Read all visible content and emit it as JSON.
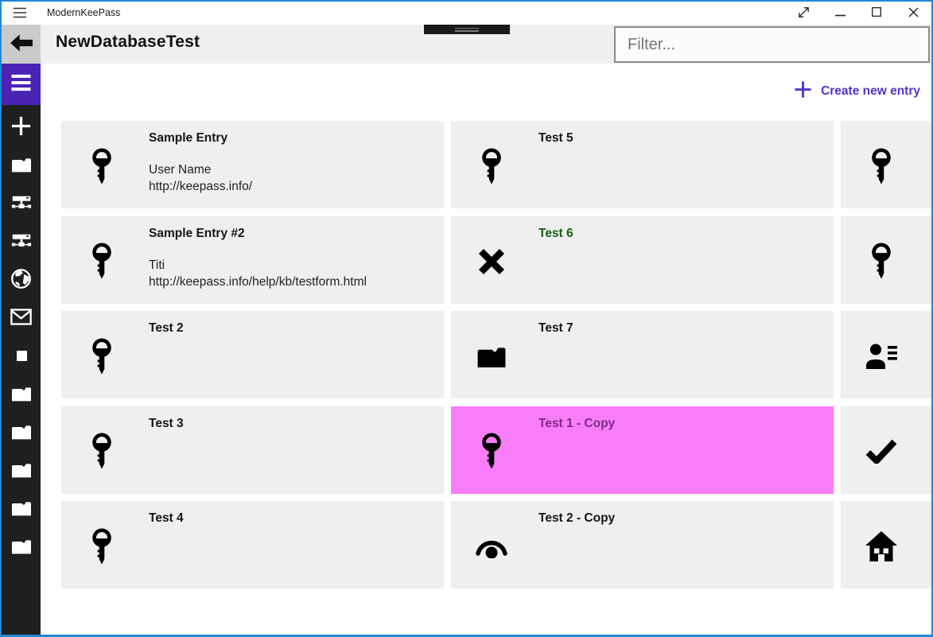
{
  "window": {
    "title": "ModernKeePass",
    "controls": [
      {
        "name": "fullscreen",
        "icon": "fullscreen"
      },
      {
        "name": "minimize",
        "icon": "minimize"
      },
      {
        "name": "maximize",
        "icon": "maximize"
      },
      {
        "name": "close",
        "icon": "close"
      }
    ]
  },
  "colors": {
    "accent": "#4b23b4",
    "create_accent": "#5233cc",
    "window_border": "#2088d8",
    "sidebar_bg": "#1f1f1f",
    "header_bg": "#efefef",
    "back_button_bg": "#cacaca",
    "card_bg": "#efefef",
    "selected_card_bg": "#f97df9",
    "selected_title": "#7e2a86",
    "green_title": "#136013"
  },
  "header": {
    "title": "NewDatabaseTest",
    "filter_placeholder": "Filter..."
  },
  "toolbar": {
    "create_label": "Create new entry"
  },
  "sidebar": {
    "items": [
      {
        "icon": "plus"
      },
      {
        "icon": "folder"
      },
      {
        "icon": "network-drive"
      },
      {
        "icon": "network-drive"
      },
      {
        "icon": "globe"
      },
      {
        "icon": "mail"
      },
      {
        "icon": "square"
      },
      {
        "icon": "folder"
      },
      {
        "icon": "folder"
      },
      {
        "icon": "folder"
      },
      {
        "icon": "folder"
      },
      {
        "icon": "folder"
      }
    ]
  },
  "entries": {
    "columns": [
      {
        "items": [
          {
            "icon": "key",
            "title": "Sample Entry",
            "lines": [
              "User Name",
              "http://keepass.info/"
            ]
          },
          {
            "icon": "key",
            "title": "Sample Entry #2",
            "lines": [
              "Titi",
              "http://keepass.info/help/kb/testform.html"
            ]
          },
          {
            "icon": "key",
            "title": "Test 2",
            "lines": []
          },
          {
            "icon": "key",
            "title": "Test 3",
            "lines": []
          },
          {
            "icon": "key",
            "title": "Test 4",
            "lines": []
          }
        ]
      },
      {
        "items": [
          {
            "icon": "key",
            "title": "Test 5",
            "lines": []
          },
          {
            "icon": "close-x",
            "title": "Test 6",
            "lines": [],
            "title_color": "#136013"
          },
          {
            "icon": "folder-filled",
            "title": "Test 7",
            "lines": []
          },
          {
            "icon": "key",
            "title": "Test 1 - Copy",
            "lines": [],
            "selected": true,
            "title_color": "#7e2a86"
          },
          {
            "icon": "eye",
            "title": "Test 2 - Copy",
            "lines": []
          }
        ]
      },
      {
        "items": [
          {
            "icon": "key",
            "title": "",
            "lines": []
          },
          {
            "icon": "key",
            "title": "",
            "lines": []
          },
          {
            "icon": "contact-details",
            "title": "",
            "lines": []
          },
          {
            "icon": "checkmark",
            "title": "",
            "lines": []
          },
          {
            "icon": "home",
            "title": "",
            "lines": []
          }
        ]
      }
    ]
  }
}
